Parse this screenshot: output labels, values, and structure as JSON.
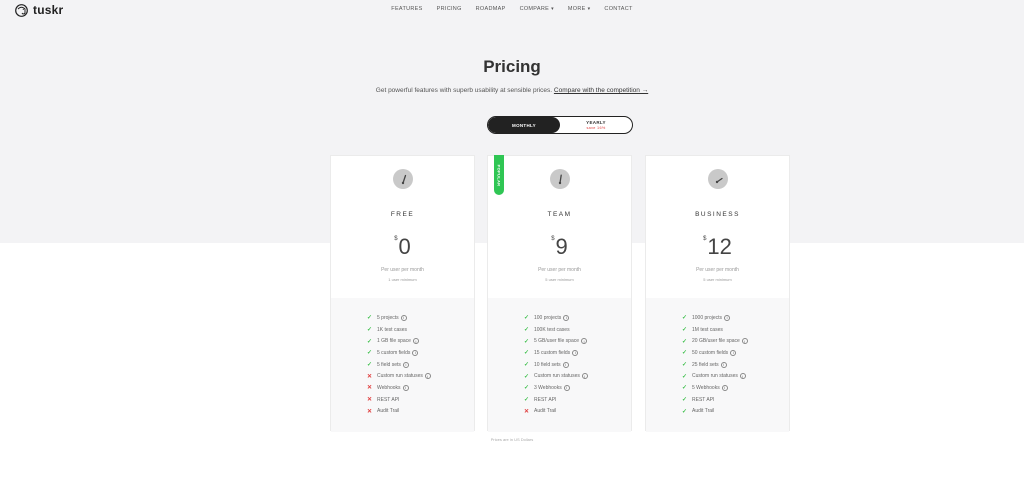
{
  "brand": {
    "name": "tuskr"
  },
  "nav": {
    "items": [
      {
        "label": "FEATURES",
        "has_caret": false
      },
      {
        "label": "PRICING",
        "has_caret": false
      },
      {
        "label": "ROADMAP",
        "has_caret": false
      },
      {
        "label": "COMPARE",
        "has_caret": true
      },
      {
        "label": "MORE",
        "has_caret": true
      },
      {
        "label": "CONTACT",
        "has_caret": false
      }
    ]
  },
  "hero": {
    "title": "Pricing",
    "subtitle": "Get powerful features with superb usability at sensible prices.",
    "compare_link": "Compare with the competition →"
  },
  "billing_toggle": {
    "monthly_label": "MONTHLY",
    "yearly_label": "YEARLY",
    "yearly_note": "save 16%",
    "selected": "monthly"
  },
  "badge": {
    "label": "POPULAR"
  },
  "plans": [
    {
      "name": "FREE",
      "currency": "$",
      "price": "0",
      "per": "Per user per month",
      "minimum": "1 user minimum",
      "features": [
        {
          "text": "5 projects",
          "included": true,
          "info": true
        },
        {
          "text": "1K test cases",
          "included": true,
          "info": false
        },
        {
          "text": "1 GB file space",
          "included": true,
          "info": true
        },
        {
          "text": "5 custom fields",
          "included": true,
          "info": true
        },
        {
          "text": "5 field sets",
          "included": true,
          "info": true
        },
        {
          "text": "Custom run statuses",
          "included": false,
          "info": true
        },
        {
          "text": "Webhooks",
          "included": false,
          "info": true
        },
        {
          "text": "REST API",
          "included": false,
          "info": false
        },
        {
          "text": "Audit Trail",
          "included": false,
          "info": false
        }
      ]
    },
    {
      "name": "TEAM",
      "currency": "$",
      "price": "9",
      "per": "Per user per month",
      "minimum": "5 user minimum",
      "features": [
        {
          "text": "100 projects",
          "included": true,
          "info": true
        },
        {
          "text": "100K test cases",
          "included": true,
          "info": false
        },
        {
          "text": "5 GB/user file space",
          "included": true,
          "info": true
        },
        {
          "text": "15 custom fields",
          "included": true,
          "info": true
        },
        {
          "text": "10 field sets",
          "included": true,
          "info": true
        },
        {
          "text": "Custom run statuses",
          "included": true,
          "info": true
        },
        {
          "text": "3 Webhooks",
          "included": true,
          "info": true
        },
        {
          "text": "REST API",
          "included": true,
          "info": false
        },
        {
          "text": "Audit Trail",
          "included": false,
          "info": false
        }
      ]
    },
    {
      "name": "BUSINESS",
      "currency": "$",
      "price": "12",
      "per": "Per user per month",
      "minimum": "5 user minimum",
      "features": [
        {
          "text": "1000 projects",
          "included": true,
          "info": true
        },
        {
          "text": "1M test cases",
          "included": true,
          "info": false
        },
        {
          "text": "20 GB/user file space",
          "included": true,
          "info": true
        },
        {
          "text": "50 custom fields",
          "included": true,
          "info": true
        },
        {
          "text": "25 field sets",
          "included": true,
          "info": true
        },
        {
          "text": "Custom run statuses",
          "included": true,
          "info": true
        },
        {
          "text": "5 Webhooks",
          "included": true,
          "info": true
        },
        {
          "text": "REST API",
          "included": true,
          "info": false
        },
        {
          "text": "Audit Trail",
          "included": true,
          "info": false
        }
      ]
    }
  ],
  "footnote": "Prices are in US Dollars",
  "colors": {
    "accent_dark": "#222222",
    "check": "#3cbf4a",
    "cross": "#e04040",
    "badge": "#2fc654",
    "hero_bg": "#f3f3f5"
  }
}
